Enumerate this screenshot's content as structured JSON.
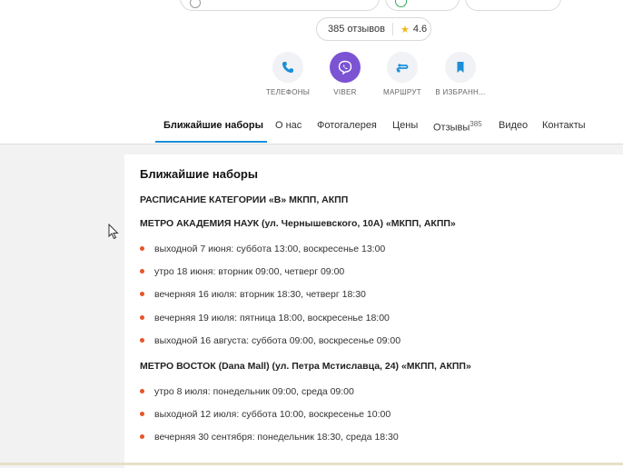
{
  "header": {
    "rating_pill": {
      "reviews": "385 отзывов",
      "rating": "4.6"
    }
  },
  "actions": [
    {
      "label": "ТЕЛЕФОНЫ"
    },
    {
      "label": "VIBER"
    },
    {
      "label": "МАРШРУТ"
    },
    {
      "label": "В ИЗБРАНН..."
    }
  ],
  "tabs": [
    {
      "label": "Ближайшие наборы"
    },
    {
      "label": "О нас"
    },
    {
      "label": "Фотогалерея"
    },
    {
      "label": "Цены"
    },
    {
      "label": "Отзывы",
      "count": "385"
    },
    {
      "label": "Видео"
    },
    {
      "label": "Контакты"
    }
  ],
  "content": {
    "title": "Ближайшие наборы",
    "schedule_heading": "РАСПИСАНИЕ КАТЕГОРИИ «В» МКПП, АКПП",
    "sections": [
      {
        "heading": "МЕТРО АКАДЕМИЯ НАУК (ул. Чернышевского, 10А) «МКПП, АКПП»",
        "items": [
          "выходной 7 июня: суббота 13:00, воскресенье 13:00",
          "утро 18 июня: вторник 09:00, четверг 09:00",
          "вечерняя 16 июля: вторник 18:30, четверг 18:30",
          "вечерняя 19 июля: пятница 18:00, воскресенье 18:00",
          "выходной 16 августа: суббота 09:00, воскресенье 09:00"
        ]
      },
      {
        "heading": "МЕТРО ВОСТОК (Dana Mall) (ул. Петра Мстиславца, 24) «МКПП, АКПП»",
        "items": [
          "утро 8 июля: понедельник 09:00, среда 09:00",
          "выходной 12 июля: суббота 10:00, воскресенье 10:00",
          "вечерняя 30 сентября: понедельник 18:30, среда 18:30"
        ]
      }
    ]
  },
  "colors": {
    "accent": "#1a8ed8",
    "viber": "#7b53d3",
    "bullet": "#e8532a",
    "star": "#f2b51b"
  }
}
